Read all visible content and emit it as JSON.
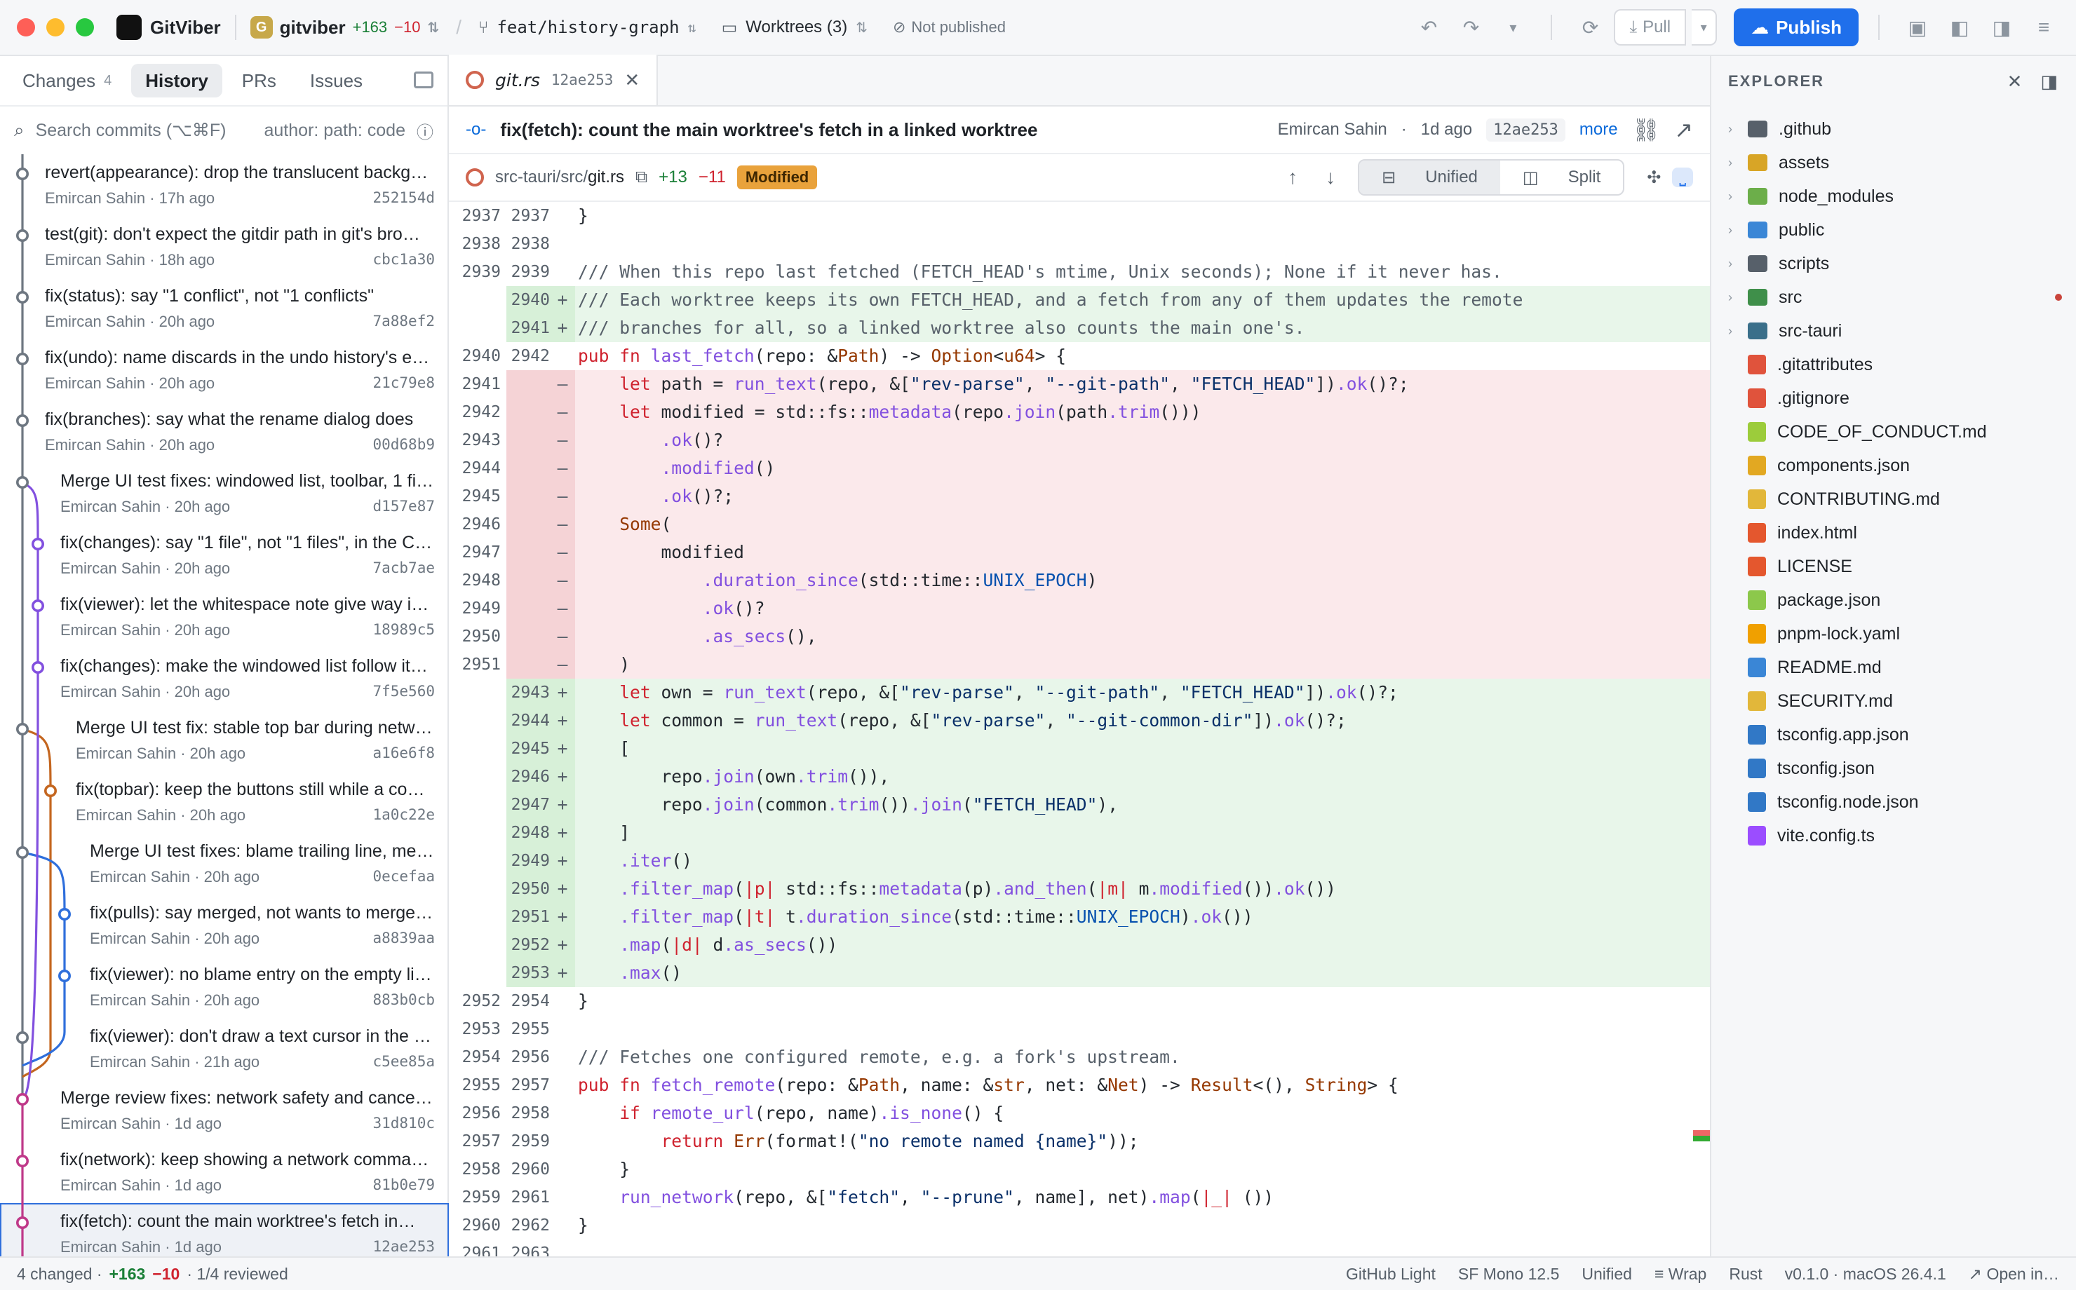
{
  "window": {
    "app_name": "GitViber",
    "repo_initial": "G",
    "repo_name": "gitviber",
    "repo_added": "+163",
    "repo_removed": "−10",
    "branch": "feat/history-graph",
    "worktrees": "Worktrees (3)",
    "publish_status": "Not published",
    "pull_label": "Pull",
    "publish_label": "Publish"
  },
  "left": {
    "tabs": [
      {
        "label": "Changes",
        "count": "4"
      },
      {
        "label": "History"
      },
      {
        "label": "PRs"
      },
      {
        "label": "Issues"
      }
    ],
    "search_placeholder": "Search commits (⌥⌘F)",
    "search_hint": "author: path: code",
    "commits": [
      {
        "msg": "revert(appearance): drop the translucent backg…",
        "author": "Emircan Sahin",
        "when": "17h ago",
        "sha": "252154d"
      },
      {
        "msg": "test(git): don't expect the gitdir path in git's bro…",
        "author": "Emircan Sahin",
        "when": "18h ago",
        "sha": "cbc1a30"
      },
      {
        "msg": "fix(status): say \"1 conflict\", not \"1 conflicts\"",
        "author": "Emircan Sahin",
        "when": "20h ago",
        "sha": "7a88ef2"
      },
      {
        "msg": "fix(undo): name discards in the undo history's e…",
        "author": "Emircan Sahin",
        "when": "20h ago",
        "sha": "21c79e8"
      },
      {
        "msg": "fix(branches): say what the rename dialog does",
        "author": "Emircan Sahin",
        "when": "20h ago",
        "sha": "00d68b9"
      },
      {
        "msg": "Merge UI test fixes: windowed list, toolbar, 1 fi…",
        "author": "Emircan Sahin",
        "when": "20h ago",
        "sha": "d157e87"
      },
      {
        "msg": "fix(changes): say \"1 file\", not \"1 files\", in the C…",
        "author": "Emircan Sahin",
        "when": "20h ago",
        "sha": "7acb7ae"
      },
      {
        "msg": "fix(viewer): let the whitespace note give way i…",
        "author": "Emircan Sahin",
        "when": "20h ago",
        "sha": "18989c5"
      },
      {
        "msg": "fix(changes): make the windowed list follow it…",
        "author": "Emircan Sahin",
        "when": "20h ago",
        "sha": "7f5e560"
      },
      {
        "msg": "Merge UI test fix: stable top bar during netw…",
        "author": "Emircan Sahin",
        "when": "20h ago",
        "sha": "a16e6f8"
      },
      {
        "msg": "fix(topbar): keep the buttons still while a co…",
        "author": "Emircan Sahin",
        "when": "20h ago",
        "sha": "1a0c22e"
      },
      {
        "msg": "Merge UI test fixes: blame trailing line, me…",
        "author": "Emircan Sahin",
        "when": "20h ago",
        "sha": "0ecefaa"
      },
      {
        "msg": "fix(pulls): say merged, not wants to merge…",
        "author": "Emircan Sahin",
        "when": "20h ago",
        "sha": "a8839aa"
      },
      {
        "msg": "fix(viewer): no blame entry on the empty li…",
        "author": "Emircan Sahin",
        "when": "20h ago",
        "sha": "883b0cb"
      },
      {
        "msg": "fix(viewer): don't draw a text cursor in the …",
        "author": "Emircan Sahin",
        "when": "21h ago",
        "sha": "c5ee85a"
      },
      {
        "msg": "Merge review fixes: network safety and cancel…",
        "author": "Emircan Sahin",
        "when": "1d ago",
        "sha": "31d810c"
      },
      {
        "msg": "fix(network): keep showing a network comma…",
        "author": "Emircan Sahin",
        "when": "1d ago",
        "sha": "81b0e79"
      },
      {
        "msg": "fix(fetch): count the main worktree's fetch in…",
        "author": "Emircan Sahin",
        "when": "1d ago",
        "sha": "12ae253"
      }
    ]
  },
  "editor": {
    "tab_file": "git.rs",
    "tab_sha": "12ae253",
    "commit_title": "fix(fetch): count the main worktree's fetch in a linked worktree",
    "commit_author": "Emircan Sahin",
    "commit_when": "1d ago",
    "commit_sha": "12ae253",
    "more_label": "more",
    "file_dir": "src-tauri/src/",
    "file_name": "git.rs",
    "file_added": "+13",
    "file_removed": "−11",
    "file_status": "Modified",
    "view_unified": "Unified",
    "view_split": "Split"
  },
  "diff_lines": [
    {
      "t": "ctx",
      "o": "2937",
      "n": "2937",
      "m": "",
      "c": "}"
    },
    {
      "t": "ctx",
      "o": "2938",
      "n": "2938",
      "m": "",
      "c": ""
    },
    {
      "t": "ctx",
      "o": "2939",
      "n": "2939",
      "m": "",
      "c": "/// When this repo last fetched (FETCH_HEAD's mtime, Unix seconds); None if it never has."
    },
    {
      "t": "add",
      "o": "",
      "n": "2940",
      "m": "+",
      "c": "/// Each worktree keeps its own FETCH_HEAD, and a fetch from any of them updates the remote"
    },
    {
      "t": "add",
      "o": "",
      "n": "2941",
      "m": "+",
      "c": "/// branches for all, so a linked worktree also counts the main one's."
    },
    {
      "t": "ctx",
      "o": "2940",
      "n": "2942",
      "m": "",
      "c": "pub fn last_fetch(repo: &Path) -> Option<u64> {"
    },
    {
      "t": "del",
      "o": "2941",
      "n": "",
      "m": "—",
      "c": "    let path = run_text(repo, &[\"rev-parse\", \"--git-path\", \"FETCH_HEAD\"]).ok()?;"
    },
    {
      "t": "del",
      "o": "2942",
      "n": "",
      "m": "—",
      "c": "    let modified = std::fs::metadata(repo.join(path.trim()))"
    },
    {
      "t": "del",
      "o": "2943",
      "n": "",
      "m": "—",
      "c": "        .ok()?"
    },
    {
      "t": "del",
      "o": "2944",
      "n": "",
      "m": "—",
      "c": "        .modified()"
    },
    {
      "t": "del",
      "o": "2945",
      "n": "",
      "m": "—",
      "c": "        .ok()?;"
    },
    {
      "t": "del",
      "o": "2946",
      "n": "",
      "m": "—",
      "c": "    Some("
    },
    {
      "t": "del",
      "o": "2947",
      "n": "",
      "m": "—",
      "c": "        modified"
    },
    {
      "t": "del",
      "o": "2948",
      "n": "",
      "m": "—",
      "c": "            .duration_since(std::time::UNIX_EPOCH)"
    },
    {
      "t": "del",
      "o": "2949",
      "n": "",
      "m": "—",
      "c": "            .ok()?"
    },
    {
      "t": "del",
      "o": "2950",
      "n": "",
      "m": "—",
      "c": "            .as_secs(),"
    },
    {
      "t": "del",
      "o": "2951",
      "n": "",
      "m": "—",
      "c": "    )"
    },
    {
      "t": "add",
      "o": "",
      "n": "2943",
      "m": "+",
      "c": "    let own = run_text(repo, &[\"rev-parse\", \"--git-path\", \"FETCH_HEAD\"]).ok()?;"
    },
    {
      "t": "add",
      "o": "",
      "n": "2944",
      "m": "+",
      "c": "    let common = run_text(repo, &[\"rev-parse\", \"--git-common-dir\"]).ok()?;"
    },
    {
      "t": "add",
      "o": "",
      "n": "2945",
      "m": "+",
      "c": "    ["
    },
    {
      "t": "add",
      "o": "",
      "n": "2946",
      "m": "+",
      "c": "        repo.join(own.trim()),"
    },
    {
      "t": "add",
      "o": "",
      "n": "2947",
      "m": "+",
      "c": "        repo.join(common.trim()).join(\"FETCH_HEAD\"),"
    },
    {
      "t": "add",
      "o": "",
      "n": "2948",
      "m": "+",
      "c": "    ]"
    },
    {
      "t": "add",
      "o": "",
      "n": "2949",
      "m": "+",
      "c": "    .iter()"
    },
    {
      "t": "add",
      "o": "",
      "n": "2950",
      "m": "+",
      "c": "    .filter_map(|p| std::fs::metadata(p).and_then(|m| m.modified()).ok())"
    },
    {
      "t": "add",
      "o": "",
      "n": "2951",
      "m": "+",
      "c": "    .filter_map(|t| t.duration_since(std::time::UNIX_EPOCH).ok())"
    },
    {
      "t": "add",
      "o": "",
      "n": "2952",
      "m": "+",
      "c": "    .map(|d| d.as_secs())"
    },
    {
      "t": "add",
      "o": "",
      "n": "2953",
      "m": "+",
      "c": "    .max()"
    },
    {
      "t": "ctx",
      "o": "2952",
      "n": "2954",
      "m": "",
      "c": "}"
    },
    {
      "t": "ctx",
      "o": "2953",
      "n": "2955",
      "m": "",
      "c": ""
    },
    {
      "t": "ctx",
      "o": "2954",
      "n": "2956",
      "m": "",
      "c": "/// Fetches one configured remote, e.g. a fork's upstream."
    },
    {
      "t": "ctx",
      "o": "2955",
      "n": "2957",
      "m": "",
      "c": "pub fn fetch_remote(repo: &Path, name: &str, net: &Net) -> Result<(), String> {"
    },
    {
      "t": "ctx",
      "o": "2956",
      "n": "2958",
      "m": "",
      "c": "    if remote_url(repo, name).is_none() {"
    },
    {
      "t": "ctx",
      "o": "2957",
      "n": "2959",
      "m": "",
      "c": "        return Err(format!(\"no remote named {name}\"));"
    },
    {
      "t": "ctx",
      "o": "2958",
      "n": "2960",
      "m": "",
      "c": "    }"
    },
    {
      "t": "ctx",
      "o": "2959",
      "n": "2961",
      "m": "",
      "c": "    run_network(repo, &[\"fetch\", \"--prune\", name], net).map(|_| ())"
    },
    {
      "t": "ctx",
      "o": "2960",
      "n": "2962",
      "m": "",
      "c": "}"
    },
    {
      "t": "ctx",
      "o": "2961",
      "n": "2963",
      "m": "",
      "c": ""
    }
  ],
  "explorer": {
    "title": "EXPLORER",
    "items": [
      {
        "name": ".github",
        "kind": "folder",
        "icon": "github-folder-icon",
        "color": "#57606a"
      },
      {
        "name": "assets",
        "kind": "folder",
        "icon": "assets-folder-icon",
        "color": "#d8a526"
      },
      {
        "name": "node_modules",
        "kind": "folder",
        "icon": "node-folder-icon",
        "color": "#6cae4a"
      },
      {
        "name": "public",
        "kind": "folder",
        "icon": "public-folder-icon",
        "color": "#3a86d6"
      },
      {
        "name": "scripts",
        "kind": "folder",
        "icon": "scripts-folder-icon",
        "color": "#57606a"
      },
      {
        "name": "src",
        "kind": "folder",
        "icon": "src-folder-icon",
        "color": "#3f8f4a",
        "modified": true
      },
      {
        "name": "src-tauri",
        "kind": "folder",
        "icon": "tauri-folder-icon",
        "color": "#3a6f8a"
      },
      {
        "name": ".gitattributes",
        "kind": "file",
        "icon": "git-icon",
        "color": "#e0533c"
      },
      {
        "name": ".gitignore",
        "kind": "file",
        "icon": "git-icon",
        "color": "#e0533c"
      },
      {
        "name": "CODE_OF_CONDUCT.md",
        "kind": "file",
        "icon": "conduct-icon",
        "color": "#9ccc3b"
      },
      {
        "name": "components.json",
        "kind": "file",
        "icon": "json-icon",
        "color": "#e2a822"
      },
      {
        "name": "CONTRIBUTING.md",
        "kind": "file",
        "icon": "contributing-icon",
        "color": "#e2b73a"
      },
      {
        "name": "index.html",
        "kind": "file",
        "icon": "html-icon",
        "color": "#e4572e"
      },
      {
        "name": "LICENSE",
        "kind": "file",
        "icon": "license-icon",
        "color": "#e4572e"
      },
      {
        "name": "package.json",
        "kind": "file",
        "icon": "nodejs-icon",
        "color": "#8cc84b"
      },
      {
        "name": "pnpm-lock.yaml",
        "kind": "file",
        "icon": "pnpm-icon",
        "color": "#f0a000"
      },
      {
        "name": "README.md",
        "kind": "file",
        "icon": "info-icon",
        "color": "#3a86d6"
      },
      {
        "name": "SECURITY.md",
        "kind": "file",
        "icon": "lock-icon",
        "color": "#e2b73a"
      },
      {
        "name": "tsconfig.app.json",
        "kind": "file",
        "icon": "tsconfig-icon",
        "color": "#3178c6"
      },
      {
        "name": "tsconfig.json",
        "kind": "file",
        "icon": "tsconfig-icon",
        "color": "#3178c6"
      },
      {
        "name": "tsconfig.node.json",
        "kind": "file",
        "icon": "tsconfig-icon",
        "color": "#3178c6"
      },
      {
        "name": "vite.config.ts",
        "kind": "file",
        "icon": "vite-icon",
        "color": "#9b4dff"
      }
    ]
  },
  "status": {
    "changed": "4 changed ·",
    "added": "+163",
    "removed": "−10",
    "reviewed": "· 1/4 reviewed",
    "theme": "GitHub Light",
    "font": "SF Mono 12.5",
    "view": "Unified",
    "wrap": "Wrap",
    "language": "Rust",
    "version": "v0.1.0 · macOS 26.4.1",
    "open_in": "Open in…"
  },
  "colors": {
    "accent": "#1f6feb",
    "added_bg": "#e8f6ea",
    "removed_bg": "#fbe9eb",
    "modified_badge": "#e9a23b"
  }
}
